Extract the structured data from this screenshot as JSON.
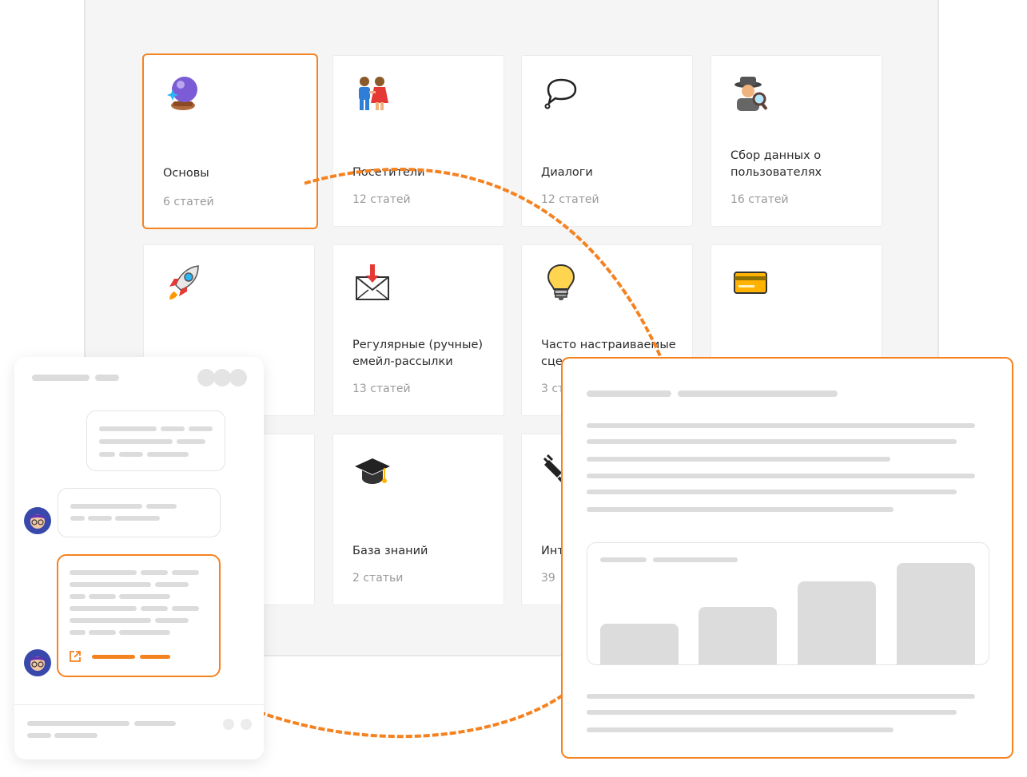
{
  "categories": [
    {
      "title": "Основы",
      "count": "6 статей",
      "icon": "crystal-ball-icon"
    },
    {
      "title": "Посетители",
      "count": "12 статей",
      "icon": "couple-icon"
    },
    {
      "title": "Диалоги",
      "count": "12 статей",
      "icon": "speech-bubble-icon"
    },
    {
      "title": "Сбор данных о пользователях",
      "count": "16 статей",
      "icon": "detective-icon"
    },
    {
      "title": "",
      "count": "",
      "icon": "rocket-icon"
    },
    {
      "title": "Регулярные (ручные) емейл-рассылки",
      "count": "13 статей",
      "icon": "envelope-arrow-icon"
    },
    {
      "title": "Часто настраиваемые сце",
      "count": "3 ст",
      "icon": "light-bulb-icon"
    },
    {
      "title": "",
      "count": "",
      "icon": "credit-card-icon"
    },
    {
      "title": "",
      "count": "",
      "icon": ""
    },
    {
      "title": "База знаний",
      "count": "2 статьи",
      "icon": "graduation-cap-icon"
    },
    {
      "title": "Инт",
      "count": "39",
      "icon": "plug-icon"
    }
  ],
  "colors": {
    "accent": "#f58220",
    "placeholder": "#dcdcdc",
    "frame": "#f5f5f5"
  }
}
